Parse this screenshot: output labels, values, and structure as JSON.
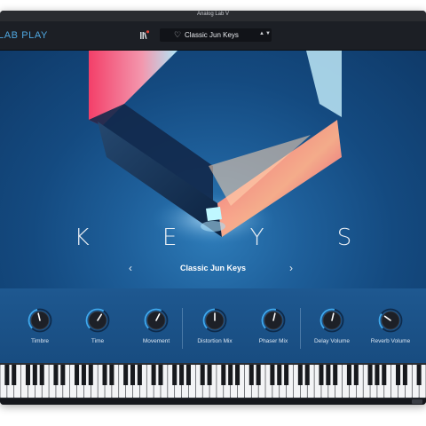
{
  "window": {
    "title": "Analog Lab V"
  },
  "topbar": {
    "brand": "LAB PLAY",
    "preset": {
      "name": "Classic Jun Keys",
      "arrows": "▲▼"
    }
  },
  "hero": {
    "title": "K E Y S",
    "preset_name": "Classic Jun Keys",
    "prev": "‹",
    "next": "›"
  },
  "controls": [
    {
      "label": "Timbre",
      "value": 0.45
    },
    {
      "label": "Time",
      "value": 0.62
    },
    {
      "label": "Movement",
      "value": 0.6
    },
    {
      "label": "Distortion Mix",
      "value": 0.5
    },
    {
      "label": "Phaser Mix",
      "value": 0.55
    },
    {
      "label": "Delay Volume",
      "value": 0.55
    },
    {
      "label": "Reverb Volume",
      "value": 0.3
    }
  ],
  "colors": {
    "accent": "#4fa7e0",
    "panel": "#1e5890",
    "background": "#1b1f27"
  }
}
